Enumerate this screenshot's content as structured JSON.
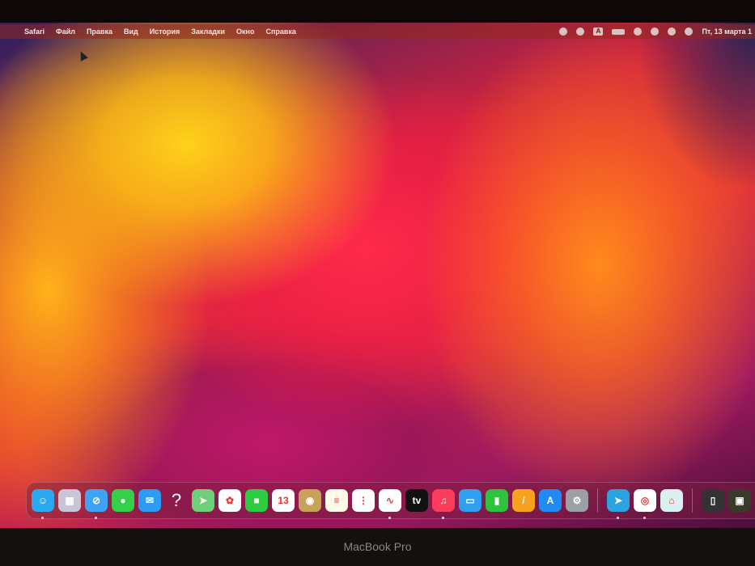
{
  "menubar": {
    "apple": "",
    "app": "Safari",
    "items": [
      "Файл",
      "Правка",
      "Вид",
      "История",
      "Закладки",
      "Окно",
      "Справка"
    ],
    "status_icons": [
      "focus-icon",
      "screen-time-icon",
      "input-source-icon",
      "battery-icon",
      "wifi-icon",
      "search-icon",
      "control-center-icon",
      "siri-icon"
    ],
    "input_source": "А",
    "clock": "Пт, 13 марта 1"
  },
  "dock": {
    "apps": [
      {
        "name": "finder",
        "glyph": "☺",
        "color": "#2aa8f0",
        "running": true
      },
      {
        "name": "launchpad",
        "glyph": "▦",
        "color": "#c9c4d6",
        "running": false
      },
      {
        "name": "safari",
        "glyph": "⊘",
        "color": "#3fa3f5",
        "running": true
      },
      {
        "name": "messages",
        "glyph": "●",
        "color": "#33d04a",
        "running": false
      },
      {
        "name": "mail",
        "glyph": "✉",
        "color": "#2c9cf2",
        "running": false
      },
      {
        "name": "help",
        "glyph": "?",
        "color": "transparent",
        "running": false
      },
      {
        "name": "maps",
        "glyph": "➤",
        "color": "#6fd07a",
        "running": false
      },
      {
        "name": "photos",
        "glyph": "✿",
        "color": "#ffffff",
        "running": false
      },
      {
        "name": "facetime",
        "glyph": "■",
        "color": "#2ecc40",
        "running": false
      },
      {
        "name": "calendar",
        "glyph": "13",
        "color": "#ffffff",
        "running": false
      },
      {
        "name": "contacts",
        "glyph": "◉",
        "color": "#c9a25a",
        "running": false
      },
      {
        "name": "notes",
        "glyph": "≡",
        "color": "#fffbe8",
        "running": false
      },
      {
        "name": "reminders",
        "glyph": "⋮",
        "color": "#ffffff",
        "running": false
      },
      {
        "name": "freeform",
        "glyph": "∿",
        "color": "#ffffff",
        "running": true
      },
      {
        "name": "tv",
        "glyph": "tv",
        "color": "#111111",
        "running": false
      },
      {
        "name": "music",
        "glyph": "♫",
        "color": "#fb3c5c",
        "running": true
      },
      {
        "name": "keynote",
        "glyph": "▭",
        "color": "#2fa0f0",
        "running": false
      },
      {
        "name": "numbers",
        "glyph": "▮",
        "color": "#2ec33c",
        "running": false
      },
      {
        "name": "pages",
        "glyph": "/",
        "color": "#f7a21c",
        "running": false
      },
      {
        "name": "app-store",
        "glyph": "A",
        "color": "#1f8cf5",
        "running": false
      },
      {
        "name": "system-settings",
        "glyph": "⚙",
        "color": "#9aa0a4",
        "running": false
      }
    ],
    "recent": [
      {
        "name": "telegram",
        "glyph": "➤",
        "color": "#2aa3e0",
        "running": true
      },
      {
        "name": "chrome",
        "glyph": "◎",
        "color": "#ffffff",
        "running": true
      },
      {
        "name": "preview",
        "glyph": "⌂",
        "color": "#d9f0f0",
        "running": false
      }
    ],
    "stack": [
      {
        "name": "iphone-mirroring",
        "glyph": "▯",
        "color": "#333333",
        "running": false
      },
      {
        "name": "screenshot",
        "glyph": "▣",
        "color": "#3a3a2a",
        "running": false
      },
      {
        "name": "trash",
        "glyph": "🗑",
        "color": "#8a8e92",
        "running": false
      }
    ]
  },
  "bezel": {
    "brand": "MacBook Pro"
  }
}
